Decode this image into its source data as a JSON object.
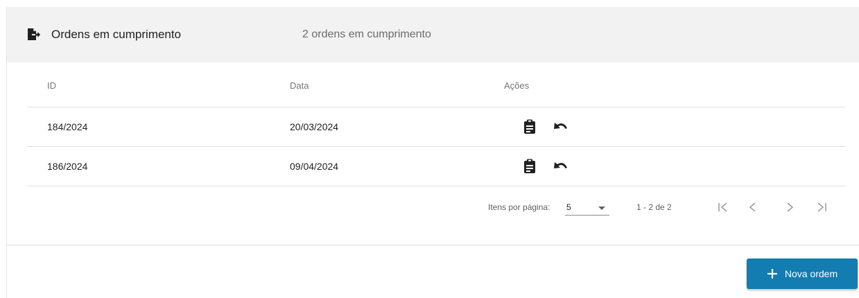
{
  "panel": {
    "icon": "export-file-icon",
    "title": "Ordens em cumprimento",
    "description": "2 ordens em cumprimento"
  },
  "table": {
    "headers": {
      "id": "ID",
      "data": "Data",
      "acoes": "Ações"
    },
    "rows": [
      {
        "id": "184/2024",
        "data": "20/03/2024",
        "actions": [
          "clipboard-icon",
          "undo-icon"
        ]
      },
      {
        "id": "186/2024",
        "data": "09/04/2024",
        "actions": [
          "clipboard-icon",
          "undo-icon"
        ]
      }
    ]
  },
  "paginator": {
    "items_label": "Itens por página:",
    "page_size": "5",
    "range": "1 - 2 de 2",
    "nav_icons": [
      "first-page-icon",
      "previous-page-icon",
      "next-page-icon",
      "last-page-icon"
    ]
  },
  "footer": {
    "new_button_label": "Nova ordem",
    "new_button_icon": "plus-icon"
  },
  "colors": {
    "header_bg": "#f2f2f2",
    "primary": "#137cb0",
    "muted_text": "#6b6b6b",
    "disabled_icon": "#9e9e9e"
  }
}
